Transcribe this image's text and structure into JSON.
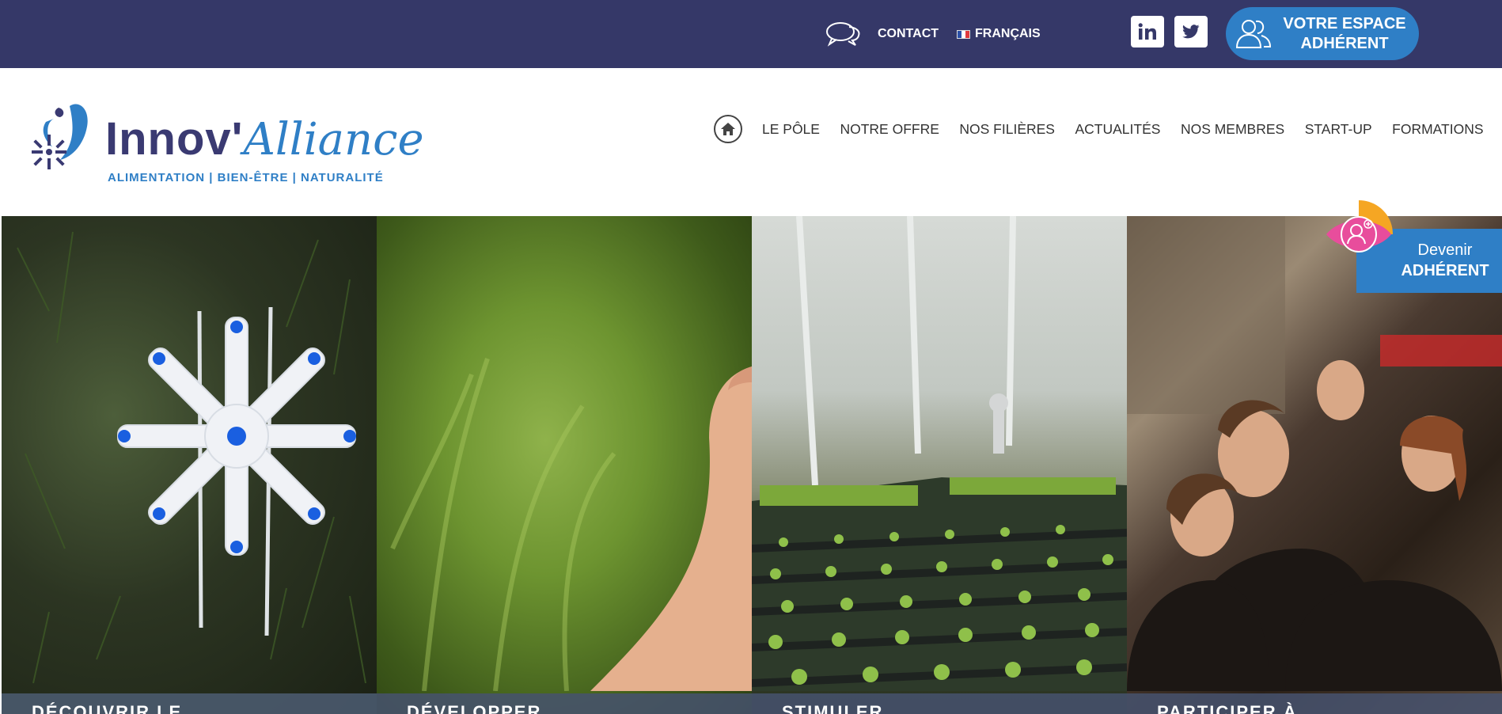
{
  "topbar": {
    "contact_label": "CONTACT",
    "language_label": "FRANÇAIS",
    "social": [
      {
        "name": "linkedin",
        "glyph": "in"
      },
      {
        "name": "twitter",
        "glyph": "twitter"
      }
    ],
    "espace_line1": "VOTRE ESPACE",
    "espace_line2": "ADHÉRENT",
    "bg_color": "#353868",
    "accent_color": "#2f7fc6"
  },
  "logo": {
    "brand_part1": "Innov'",
    "brand_part2": "Alliance",
    "tagline": "ALIMENTATION | BIEN-ÊTRE | NATURALITÉ"
  },
  "nav": {
    "home_icon": "home-icon",
    "items": [
      "LE PÔLE",
      "NOTRE OFFRE",
      "NOS FILIÈRES",
      "ACTUALITÉS",
      "NOS MEMBRES",
      "START-UP",
      "FORMATIONS"
    ]
  },
  "panels": [
    {
      "caption": "DÉCOUVRIR LE"
    },
    {
      "caption": "DÉVELOPPER"
    },
    {
      "caption": "STIMULER"
    },
    {
      "caption": "PARTICIPER À"
    }
  ],
  "devenir": {
    "line1": "Devenir",
    "line2": "ADHÉRENT"
  }
}
